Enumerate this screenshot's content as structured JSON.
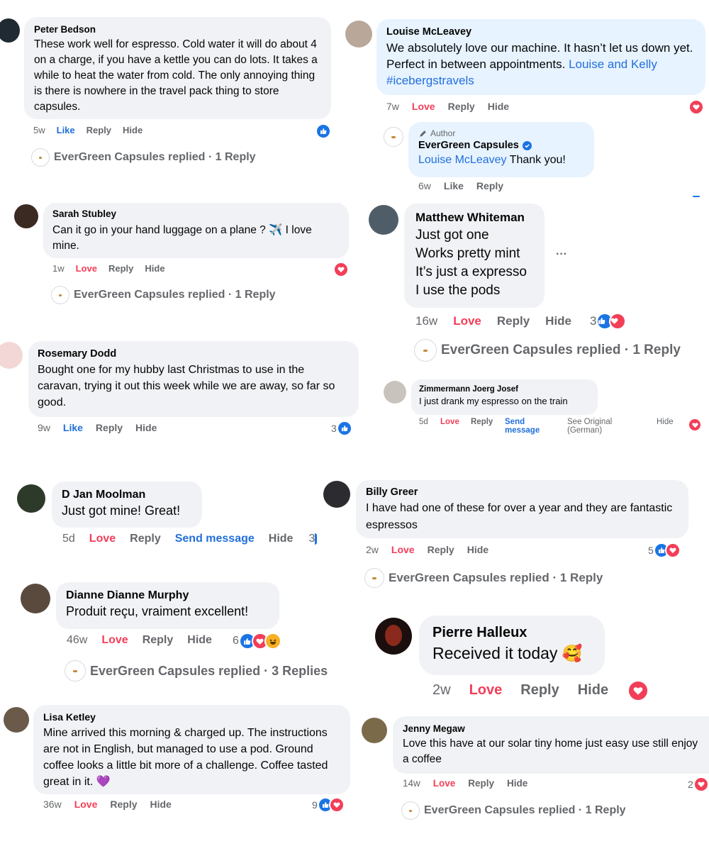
{
  "colors": {
    "bubble": "#f0f2f5",
    "bubble_highlight": "#e7f3ff",
    "love": "#f33e58",
    "like": "#216fdb",
    "meta": "#65676b"
  },
  "action_labels": {
    "like": "Like",
    "love": "Love",
    "reply": "Reply",
    "hide": "Hide",
    "send_message": "Send message",
    "see_original": "See Original (German)"
  },
  "comments": {
    "peter": {
      "name": "Peter Bedson",
      "text": "These work well for espresso. Cold water it will do about 4 on a charge, if you have a kettle you can do lots. It takes a while to heat the water from cold. The only annoying thing is there is nowhere in the travel pack thing to store capsules.",
      "time": "5w",
      "replied": "EverGreen Capsules replied · 1 Reply"
    },
    "louise": {
      "name": "Louise McLeavey",
      "text": "We absolutely love our machine. It hasn’t let us down yet. Perfect in between appointments.",
      "tag": "Louise and Kelly #icebergstravels",
      "time": "7w"
    },
    "author_reply": {
      "badge": "Author",
      "name": "EverGreen Capsules",
      "mention": "Louise McLeavey",
      "text": " Thank you!",
      "time": "6w"
    },
    "sarah": {
      "name": "Sarah Stubley",
      "text": "Can it go in your hand luggage on a plane ? ✈️ I love mine.",
      "time": "1w",
      "replied": "EverGreen Capsules replied · 1 Reply"
    },
    "matthew": {
      "name": "Matthew Whiteman",
      "lines": [
        "Just got one",
        "Works pretty mint",
        "It’s just a expresso",
        "I use the pods"
      ],
      "time": "16w",
      "count": "3",
      "more": "···",
      "replied": "EverGreen Capsules replied · 1 Reply"
    },
    "rosemary": {
      "name": "Rosemary Dodd",
      "text": "Bought one for my hubby last Christmas to use in the caravan, trying it out this week while we are away, so far so good.",
      "time": "9w",
      "count": "3"
    },
    "zimmermann": {
      "name": "Zimmermann Joerg Josef",
      "text": "I just drank my espresso on the train",
      "time": "5d",
      "send1": "Send",
      "send2": "message",
      "orig1": "See Original",
      "orig2": "(German)"
    },
    "djan": {
      "name": "D Jan Moolman",
      "text": "Just got mine! Great!",
      "time": "5d",
      "count": "3"
    },
    "billy": {
      "name": "Billy Greer",
      "text": "I have had one of these for over a year and they are fantastic espressos",
      "time": "2w",
      "count": "5",
      "replied": "EverGreen Capsules replied · 1 Reply"
    },
    "dianne": {
      "name": "Dianne Dianne Murphy",
      "text": "Produit reçu, vraiment excellent!",
      "time": "46w",
      "count": "6",
      "replied": "EverGreen Capsules replied · 3 Replies"
    },
    "pierre": {
      "name": "Pierre Halleux",
      "text": "Received it today 🥰",
      "time": "2w"
    },
    "lisa": {
      "name": "Lisa Ketley",
      "text": "Mine arrived this morning & charged up. The instructions are not in English, but managed to use a pod. Ground coffee looks a little bit more of a challenge. Coffee tasted great in it. 💜",
      "time": "36w",
      "count": "9"
    },
    "jenny": {
      "name": "Jenny Megaw",
      "text": "Love this have at our solar tiny home just easy use still enjoy a coffee",
      "time": "14w",
      "count": "2",
      "replied": "EverGreen Capsules replied · 1 Reply"
    }
  }
}
